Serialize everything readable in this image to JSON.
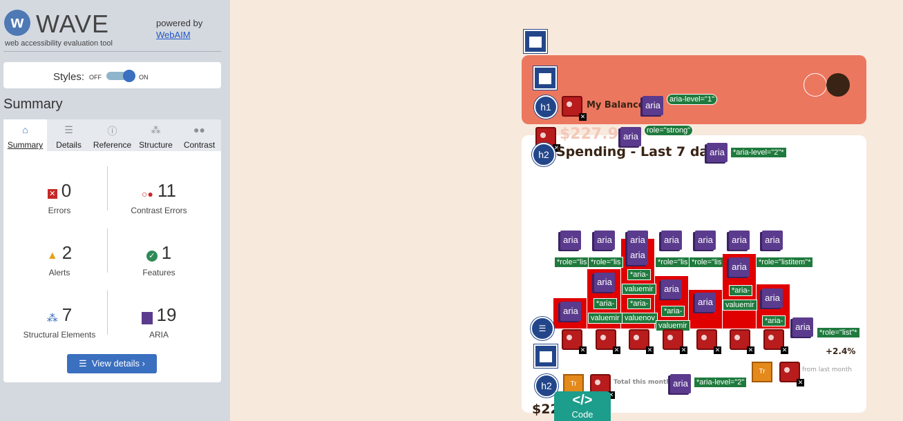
{
  "wave": {
    "title": "WAVE",
    "tagline": "web accessibility evaluation tool",
    "powered_by": "powered by",
    "webaim": "WebAIM",
    "styles_label": "Styles:",
    "off": "OFF",
    "on": "ON",
    "summary_heading": "Summary",
    "tabs": [
      "Summary",
      "Details",
      "Reference",
      "Structure",
      "Contrast"
    ],
    "stats": {
      "errors": {
        "value": "0",
        "label": "Errors"
      },
      "contrast": {
        "value": "11",
        "label": "Contrast Errors"
      },
      "alerts": {
        "value": "2",
        "label": "Alerts"
      },
      "features": {
        "value": "1",
        "label": "Features"
      },
      "structure": {
        "value": "7",
        "label": "Structural Elements"
      },
      "aria": {
        "value": "19",
        "label": "ARIA"
      }
    },
    "view_details": "View details ›",
    "colors": {
      "accent": "#3b6fbf",
      "sidebar": "#d4d9e0",
      "error": "#b81c1c",
      "alert": "#e4a21b",
      "feature": "#2e8b57",
      "aria": "#5b3b8d"
    }
  },
  "page": {
    "balance_label": "My Balance",
    "balance_amount": "$227.94",
    "spending_heading": "Spending - Last 7 days",
    "change": "+2.4%",
    "total_label": "Total this month",
    "from_last": "from last month",
    "total_amount": "$22",
    "code_label": "Code",
    "colors": {
      "top_card": "#ec775f",
      "background": "#f8e9dd",
      "text": "#382314",
      "code_tab": "#1d9d8b"
    }
  },
  "overlay": {
    "aria": "aria",
    "h1": "h1",
    "h2": "h2",
    "aria_level_1": "aria-level=\"1\"",
    "role_strong": "role=\"strong\"",
    "aria_level_2": "*aria-level=\"2\"*",
    "aria_level_2b": "*aria-level=\"2\"",
    "role_list": "*role=\"list\"*",
    "role_listitem": "*role=\"listitem\"*",
    "role_li_short": "*role=\"lis",
    "aria_dash": "*aria-",
    "valuemin": "valuemir",
    "valuenow": "valuenov",
    "alert_icon": "Tr"
  }
}
